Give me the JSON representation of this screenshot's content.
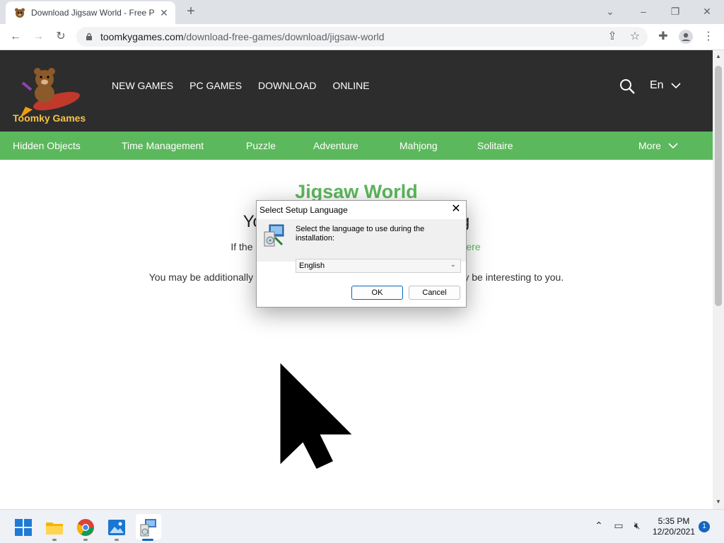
{
  "browser": {
    "tab_title": "Download Jigsaw World - Free P",
    "url_host": "toomkygames.com",
    "url_path": "/download-free-games/download/jigsaw-world"
  },
  "site": {
    "brand": "Toomky Games",
    "top_nav": [
      "NEW GAMES",
      "PC GAMES",
      "DOWNLOAD",
      "ONLINE"
    ],
    "language": "En",
    "categories": [
      "Hidden Objects",
      "Time Management",
      "Puzzle",
      "Adventure",
      "Mahjong",
      "Solitaire"
    ],
    "more_label": "More",
    "accent_color": "#5cb85c"
  },
  "content": {
    "game_title": "Jigsaw World",
    "heading_left": "You",
    "heading_right": "ng",
    "line2_left": "If the",
    "line2_link": "ere",
    "line3_left": "You may be additionally as",
    "line3_right": "ay be interesting to you."
  },
  "dialog": {
    "title": "Select Setup Language",
    "prompt": "Select the language to use during the installation:",
    "selected_language": "English",
    "ok_label": "OK",
    "cancel_label": "Cancel"
  },
  "taskbar": {
    "time": "5:35 PM",
    "date": "12/20/2021",
    "notification_count": "1"
  }
}
